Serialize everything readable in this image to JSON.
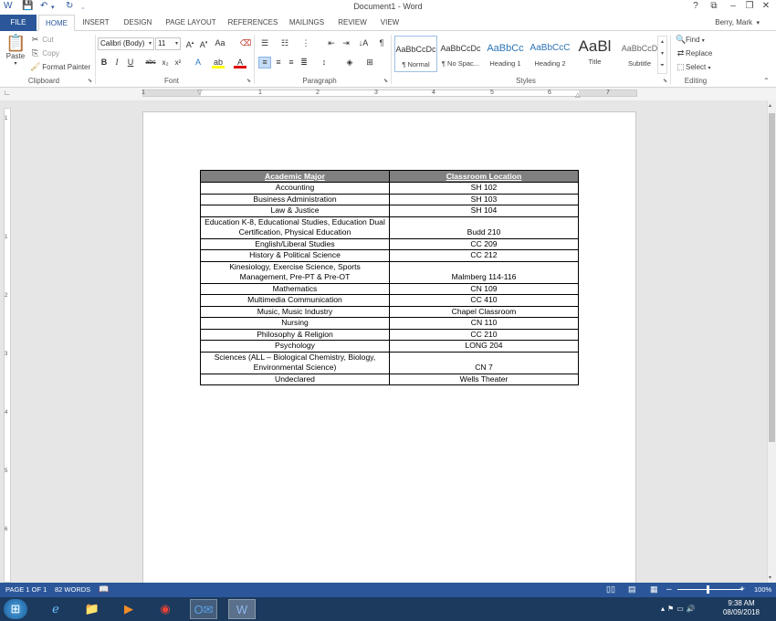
{
  "window": {
    "title": "Document1 - Word",
    "user": "Berry, Mark",
    "help": "?",
    "ribbon_opts": "⧉",
    "minimize": "–",
    "restore": "❐",
    "close": "✕"
  },
  "tabs": [
    "FILE",
    "HOME",
    "INSERT",
    "DESIGN",
    "PAGE LAYOUT",
    "REFERENCES",
    "MAILINGS",
    "REVIEW",
    "VIEW"
  ],
  "ribbon": {
    "clipboard": {
      "paste": "Paste",
      "cut": "Cut",
      "copy": "Copy",
      "format_painter": "Format Painter",
      "label": "Clipboard"
    },
    "font": {
      "family": "Calibri (Body)",
      "size": "11",
      "label": "Font"
    },
    "paragraph": {
      "label": "Paragraph"
    },
    "styles": {
      "label": "Styles",
      "items": [
        {
          "preview": "AaBbCcDc",
          "name": "¶ Normal"
        },
        {
          "preview": "AaBbCcDc",
          "name": "¶ No Spac..."
        },
        {
          "preview": "AaBbCc",
          "name": "Heading 1"
        },
        {
          "preview": "AaBbCcC",
          "name": "Heading 2"
        },
        {
          "preview": "AaBl",
          "name": "Title"
        },
        {
          "preview": "AaBbCcD",
          "name": "Subtitle"
        }
      ]
    },
    "editing": {
      "find": "Find",
      "replace": "Replace",
      "select": "Select",
      "label": "Editing"
    }
  },
  "ruler": {
    "marks": [
      "1",
      "1",
      "2",
      "3",
      "4",
      "5",
      "6",
      "7"
    ]
  },
  "vruler": {
    "marks": [
      "1",
      "1",
      "2",
      "3",
      "4",
      "5",
      "6"
    ]
  },
  "table": {
    "headers": [
      "Academic Major",
      "Classroom Location"
    ],
    "rows": [
      {
        "major": "Accounting",
        "loc": "SH 102"
      },
      {
        "major": "Business Administration",
        "loc": "SH 103"
      },
      {
        "major": "Law & Justice",
        "loc": "SH 104"
      },
      {
        "major": "Education K-8, Educational Studies, Education Dual Certification, Physical Education",
        "loc": "Budd 210"
      },
      {
        "major": "English/Liberal Studies",
        "loc": "CC 209"
      },
      {
        "major": "History & Political Science",
        "loc": "CC 212"
      },
      {
        "major": "Kinesiology, Exercise Science, Sports Management, Pre-PT & Pre-OT",
        "loc": "Malmberg 114-116"
      },
      {
        "major": "Mathematics",
        "loc": "CN 109"
      },
      {
        "major": "Multimedia Communication",
        "loc": "CC 410"
      },
      {
        "major": "Music, Music Industry",
        "loc": "Chapel Classroom"
      },
      {
        "major": "Nursing",
        "loc": "CN 110"
      },
      {
        "major": "Philosophy & Religion",
        "loc": "CC 210"
      },
      {
        "major": "Psychology",
        "loc": "LONG 204"
      },
      {
        "major": "Sciences (ALL – Biological Chemistry, Biology, Environmental Science)",
        "loc": "CN 7"
      },
      {
        "major": "Undeclared",
        "loc": "Wells Theater"
      }
    ]
  },
  "status": {
    "page": "PAGE 1 OF 1",
    "words": "82 WORDS",
    "zoom": "100%"
  },
  "clock": {
    "time": "9:38 AM",
    "date": "08/09/2018"
  },
  "colors": {
    "accent": "#2b579a",
    "header_fill": "#808080",
    "taskbar": "#1c3a5d"
  }
}
